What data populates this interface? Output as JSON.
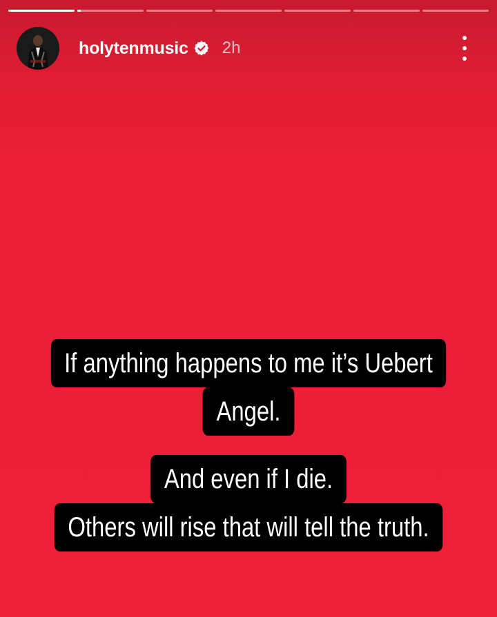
{
  "story": {
    "segments_total": 7,
    "segments_progress": [
      1,
      0.05,
      0,
      0,
      0,
      0,
      0
    ],
    "background_color": "#ef1f38",
    "caption_bg_color": "#000000"
  },
  "header": {
    "username": "holytenmusic",
    "verified": true,
    "timestamp": "2h",
    "avatar_icon": "avatar-photo",
    "more_icon": "more-vertical-icon"
  },
  "captions": [
    {
      "line1": "If anything happens to me it’s Uebert",
      "line2": "Angel."
    },
    {
      "line1": "And even if I die.",
      "line2": "Others will rise that will tell the truth."
    }
  ]
}
